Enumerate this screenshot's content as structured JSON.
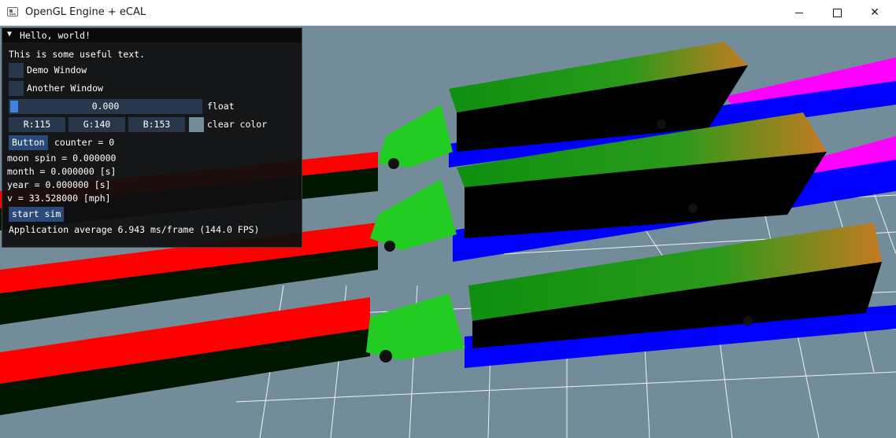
{
  "window": {
    "title": "OpenGL Engine + eCAL",
    "icon": "app-window-icon",
    "controls": {
      "minimize_icon": "minimize-icon",
      "maximize_icon": "maximize-icon",
      "close_glyph": "✕"
    }
  },
  "scene": {
    "background_color": "#738c99",
    "grid_color": "#ffffff",
    "lane_colors": {
      "left": "#ff0000",
      "right": "#0000ff",
      "magenta": "#ff00ff",
      "shadow": "#001600"
    }
  },
  "imgui": {
    "title": "Hello, world!",
    "collapse_glyph": "▼",
    "useful_text": "This is some useful text.",
    "checkbox_demo": "Demo Window",
    "checkbox_another": "Another Window",
    "slider_value": "0.000",
    "slider_label": "float",
    "color_r": "R:115",
    "color_g": "G:140",
    "color_b": "B:153",
    "color_label": "clear color",
    "clear_color": "#738c99",
    "button_label": "Button",
    "counter_text": "counter = 0",
    "moon_spin": "moon spin = 0.000000",
    "month": "month = 0.000000 [s]",
    "year": "year = 0.000000 [s]",
    "velocity": "v = 33.528000 [mph]",
    "start_sim": "start sim",
    "fps_text": "Application average 6.943 ms/frame (144.0 FPS)"
  }
}
